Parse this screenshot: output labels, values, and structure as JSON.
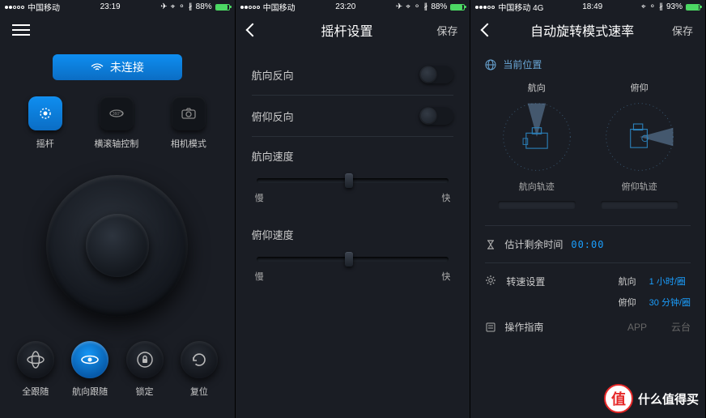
{
  "status": {
    "carrier": "中国移动",
    "network4g": "中国移动  4G",
    "time1": "23:19",
    "time2": "23:20",
    "time3": "18:49",
    "battery1": "88%",
    "battery2": "88%",
    "battery3": "93%"
  },
  "screen1": {
    "connect_label": "未连接",
    "icons": {
      "joystick": "摇杆",
      "roll": "横滚轴控制",
      "camera": "相机模式"
    },
    "modes": {
      "full_follow": "全跟随",
      "heading_follow": "航向跟随",
      "lock": "锁定",
      "reset": "复位"
    }
  },
  "screen2": {
    "title": "摇杆设置",
    "save": "保存",
    "heading_reverse": "航向反向",
    "pitch_reverse": "俯仰反向",
    "heading_speed": "航向速度",
    "pitch_speed": "俯仰速度",
    "slow": "慢",
    "fast": "快"
  },
  "screen3": {
    "title": "自动旋转模式速率",
    "save": "保存",
    "current_pos": "当前位置",
    "heading": "航向",
    "pitch": "俯仰",
    "heading_track": "航向轨迹",
    "pitch_track": "俯仰轨迹",
    "est_time_label": "估计剩余时间",
    "est_time_value": "00:00",
    "speed_setting": "转速设置",
    "heading_val": "1 小时/圈",
    "pitch_val": "30 分钟/圈",
    "guide": "操作指南",
    "app": "APP",
    "gimbal": "云台"
  },
  "watermark": "什么值得买",
  "watermark_badge": "值"
}
